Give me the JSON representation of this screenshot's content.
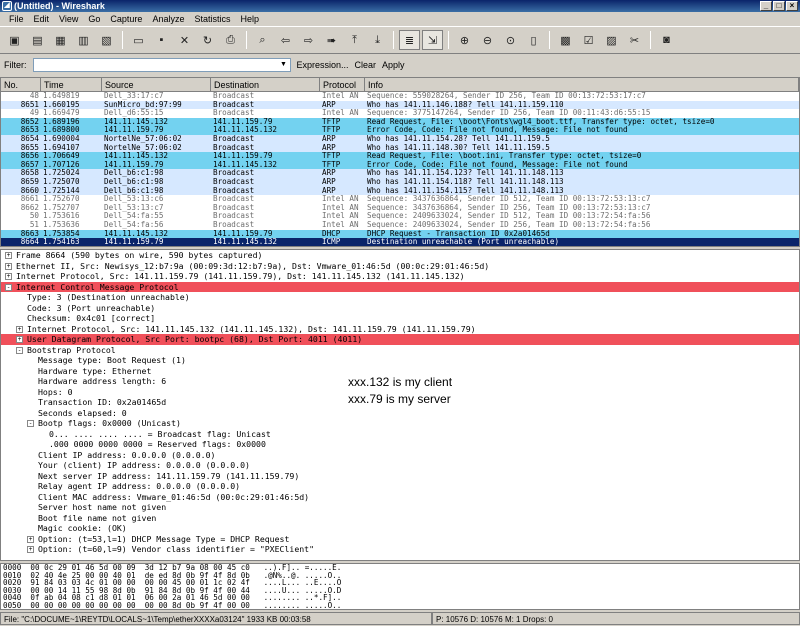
{
  "window": {
    "title": "(Untitled) - Wireshark",
    "app_icon": "wireshark-fin-icon"
  },
  "menu": [
    "File",
    "Edit",
    "View",
    "Go",
    "Capture",
    "Analyze",
    "Statistics",
    "Help"
  ],
  "toolbar": {
    "icons": [
      "interface-list-icon",
      "capture-options-icon",
      "start-capture-icon",
      "restart-capture-icon",
      "stop-capture-icon",
      "open-file-icon",
      "save-file-icon",
      "close-file-icon",
      "reload-icon",
      "print-icon",
      "find-packet-icon",
      "go-back-icon",
      "go-forward-icon",
      "go-to-packet-icon",
      "go-first-icon",
      "go-last-icon",
      "colorize-icon",
      "auto-scroll-icon",
      "zoom-in-icon",
      "zoom-out-icon",
      "zoom-normal-icon",
      "resize-columns-icon",
      "capture-filters-icon",
      "display-filters-icon",
      "coloring-rules-icon",
      "preferences-icon",
      "help-icon"
    ]
  },
  "filter": {
    "label": "Filter:",
    "value": "",
    "expression_label": "Expression...",
    "clear_label": "Clear",
    "apply_label": "Apply"
  },
  "packet_list": {
    "columns": [
      "No.",
      "Time",
      "Source",
      "Destination",
      "Protocol",
      "Info"
    ],
    "rows": [
      {
        "no": "48",
        "time": "1.649819",
        "src": "Dell_33:17:c7",
        "dst": "Broadcast",
        "proto": "Intel AN",
        "info": "Sequence: 559028264, Sender ID 256, Team ID 00:13:72:53:17:c7",
        "bg": "#ffffff",
        "fg": "#6e6e6e"
      },
      {
        "no": "8651",
        "time": "1.660195",
        "src": "SunMicro_bd:97:99",
        "dst": "Broadcast",
        "proto": "ARP",
        "info": "Who has 141.11.146.188?  Tell 141.11.159.110",
        "bg": "#d6e8ff",
        "fg": "#000000"
      },
      {
        "no": "49",
        "time": "1.669479",
        "src": "Dell_d6:55:15",
        "dst": "Broadcast",
        "proto": "Intel AN",
        "info": "Sequence: 3775147264, Sender ID 256, Team ID 00:11:43:d6:55:15",
        "bg": "#ffffff",
        "fg": "#6e6e6e"
      },
      {
        "no": "8652",
        "time": "1.689196",
        "src": "141.11.145.132",
        "dst": "141.11.159.79",
        "proto": "TFTP",
        "info": "Read Request, File: \\boot\\Fonts\\wgl4_boot.ttf, Transfer type: octet, tsize=0",
        "bg": "#73d2f0",
        "fg": "#000000"
      },
      {
        "no": "8653",
        "time": "1.689800",
        "src": "141.11.159.79",
        "dst": "141.11.145.132",
        "proto": "TFTP",
        "info": "Error Code, Code: File not found, Message: File not found",
        "bg": "#73d2f0",
        "fg": "#000000"
      },
      {
        "no": "8654",
        "time": "1.690004",
        "src": "NortelNe_57:06:02",
        "dst": "Broadcast",
        "proto": "ARP",
        "info": "Who has 141.11.154.28?  Tell 141.11.159.5",
        "bg": "#d6e8ff",
        "fg": "#000000"
      },
      {
        "no": "8655",
        "time": "1.694107",
        "src": "NortelNe_57:06:02",
        "dst": "Broadcast",
        "proto": "ARP",
        "info": "Who has 141.11.148.30?  Tell 141.11.159.5",
        "bg": "#d6e8ff",
        "fg": "#000000"
      },
      {
        "no": "8656",
        "time": "1.706649",
        "src": "141.11.145.132",
        "dst": "141.11.159.79",
        "proto": "TFTP",
        "info": "Read Request, File: \\boot.ini, Transfer type: octet, tsize=0",
        "bg": "#73d2f0",
        "fg": "#000000"
      },
      {
        "no": "8657",
        "time": "1.707126",
        "src": "141.11.159.79",
        "dst": "141.11.145.132",
        "proto": "TFTP",
        "info": "Error Code, Code: File not found, Message: File not found",
        "bg": "#73d2f0",
        "fg": "#000000"
      },
      {
        "no": "8658",
        "time": "1.725024",
        "src": "Dell_b6:c1:98",
        "dst": "Broadcast",
        "proto": "ARP",
        "info": "Who has 141.11.154.123?  Tell 141.11.148.113",
        "bg": "#d6e8ff",
        "fg": "#000000"
      },
      {
        "no": "8659",
        "time": "1.725070",
        "src": "Dell_b6:c1:98",
        "dst": "Broadcast",
        "proto": "ARP",
        "info": "Who has 141.11.154.118?  Tell 141.11.148.113",
        "bg": "#d6e8ff",
        "fg": "#000000"
      },
      {
        "no": "8660",
        "time": "1.725144",
        "src": "Dell_b6:c1:98",
        "dst": "Broadcast",
        "proto": "ARP",
        "info": "Who has 141.11.154.115?  Tell 141.11.148.113",
        "bg": "#d6e8ff",
        "fg": "#000000"
      },
      {
        "no": "8661",
        "time": "1.752670",
        "src": "Dell_53:13:c6",
        "dst": "Broadcast",
        "proto": "Intel AN",
        "info": "Sequence: 3437636864, Sender ID 512, Team ID 00:13:72:53:13:c7",
        "bg": "#ffffff",
        "fg": "#6e6e6e"
      },
      {
        "no": "8662",
        "time": "1.752707",
        "src": "Dell_53:13:c7",
        "dst": "Broadcast",
        "proto": "Intel AN",
        "info": "Sequence: 3437636864, Sender ID 256, Team ID 00:13:72:53:13:c7",
        "bg": "#ffffff",
        "fg": "#6e6e6e"
      },
      {
        "no": "50",
        "time": "1.753616",
        "src": "Dell_54:fa:55",
        "dst": "Broadcast",
        "proto": "Intel AN",
        "info": "Sequence: 2409633024, Sender ID 512, Team ID 00:13:72:54:fa:56",
        "bg": "#ffffff",
        "fg": "#6e6e6e"
      },
      {
        "no": "51",
        "time": "1.753636",
        "src": "Dell_54:fa:56",
        "dst": "Broadcast",
        "proto": "Intel AN",
        "info": "Sequence: 2409633024, Sender ID 256, Team ID 00:13:72:54:fa:56",
        "bg": "#ffffff",
        "fg": "#6e6e6e"
      },
      {
        "no": "8663",
        "time": "1.753854",
        "src": "141.11.145.132",
        "dst": "141.11.159.79",
        "proto": "DHCP",
        "info": "DHCP Request  - Transaction ID 0x2a01465d",
        "bg": "#73d2f0",
        "fg": "#000000"
      },
      {
        "no": "8664",
        "time": "1.754163",
        "src": "141.11.159.79",
        "dst": "141.11.145.132",
        "proto": "ICMP",
        "info": "Destination unreachable (Port unreachable)",
        "bg": "#0a246a",
        "fg": "#ffffff"
      }
    ]
  },
  "details": [
    {
      "indent": 0,
      "exp": "+",
      "text": "Frame 8664 (590 bytes on wire, 590 bytes captured)",
      "hl": false
    },
    {
      "indent": 0,
      "exp": "+",
      "text": "Ethernet II, Src: Newisys_12:b7:9a (00:09:3d:12:b7:9a), Dst: Vmware_01:46:5d (00:0c:29:01:46:5d)",
      "hl": false
    },
    {
      "indent": 0,
      "exp": "+",
      "text": "Internet Protocol, Src: 141.11.159.79 (141.11.159.79), Dst: 141.11.145.132 (141.11.145.132)",
      "hl": false
    },
    {
      "indent": 0,
      "exp": "-",
      "text": "Internet Control Message Protocol",
      "hl": true
    },
    {
      "indent": 1,
      "exp": "",
      "text": "Type: 3 (Destination unreachable)",
      "hl": false
    },
    {
      "indent": 1,
      "exp": "",
      "text": "Code: 3 (Port unreachable)",
      "hl": false
    },
    {
      "indent": 1,
      "exp": "",
      "text": "Checksum: 0x4c01 [correct]",
      "hl": false
    },
    {
      "indent": 1,
      "exp": "+",
      "text": "Internet Protocol, Src: 141.11.145.132 (141.11.145.132), Dst: 141.11.159.79 (141.11.159.79)",
      "hl": false
    },
    {
      "indent": 1,
      "exp": "+",
      "text": "User Datagram Protocol, Src Port: bootpc (68), Dst Port: 4011 (4011)",
      "hl": true
    },
    {
      "indent": 1,
      "exp": "-",
      "text": "Bootstrap Protocol",
      "hl": false
    },
    {
      "indent": 2,
      "exp": "",
      "text": "Message type: Boot Request (1)",
      "hl": false
    },
    {
      "indent": 2,
      "exp": "",
      "text": "Hardware type: Ethernet",
      "hl": false
    },
    {
      "indent": 2,
      "exp": "",
      "text": "Hardware address length: 6",
      "hl": false
    },
    {
      "indent": 2,
      "exp": "",
      "text": "Hops: 0",
      "hl": false
    },
    {
      "indent": 2,
      "exp": "",
      "text": "Transaction ID: 0x2a01465d",
      "hl": false
    },
    {
      "indent": 2,
      "exp": "",
      "text": "Seconds elapsed: 0",
      "hl": false
    },
    {
      "indent": 2,
      "exp": "-",
      "text": "Bootp flags: 0x0000 (Unicast)",
      "hl": false
    },
    {
      "indent": 3,
      "exp": "",
      "text": "0... .... .... .... = Broadcast flag: Unicast",
      "hl": false
    },
    {
      "indent": 3,
      "exp": "",
      "text": ".000 0000 0000 0000 = Reserved flags: 0x0000",
      "hl": false
    },
    {
      "indent": 2,
      "exp": "",
      "text": "Client IP address: 0.0.0.0 (0.0.0.0)",
      "hl": false
    },
    {
      "indent": 2,
      "exp": "",
      "text": "Your (client) IP address: 0.0.0.0 (0.0.0.0)",
      "hl": false
    },
    {
      "indent": 2,
      "exp": "",
      "text": "Next server IP address: 141.11.159.79 (141.11.159.79)",
      "hl": false
    },
    {
      "indent": 2,
      "exp": "",
      "text": "Relay agent IP address: 0.0.0.0 (0.0.0.0)",
      "hl": false
    },
    {
      "indent": 2,
      "exp": "",
      "text": "Client MAC address: Vmware_01:46:5d (00:0c:29:01:46:5d)",
      "hl": false
    },
    {
      "indent": 2,
      "exp": "",
      "text": "Server host name not given",
      "hl": false
    },
    {
      "indent": 2,
      "exp": "",
      "text": "Boot file name not given",
      "hl": false
    },
    {
      "indent": 2,
      "exp": "",
      "text": "Magic cookie: (OK)",
      "hl": false
    },
    {
      "indent": 2,
      "exp": "+",
      "text": "Option: (t=53,l=1) DHCP Message Type = DHCP Request",
      "hl": false
    },
    {
      "indent": 2,
      "exp": "+",
      "text": "Option: (t=60,l=9) Vendor class identifier = \"PXEClient\"",
      "hl": false
    }
  ],
  "annotation": {
    "line1": "xxx.132 is my client",
    "line2": "xxx.79 is my server"
  },
  "hex": [
    "0000  00 0c 29 01 46 5d 00 09  3d 12 b7 9a 08 00 45 c0   ..).F].. =.....E.",
    "0010  02 40 4e 25 00 00 40 01  de ed 8d 0b 9f 4f 8d 0b   .@N%..@. .....O..",
    "0020  91 84 03 03 4c 01 00 00  00 00 45 00 01 1c 02 4f   ....L... ..E....O",
    "0030  00 00 14 11 55 98 8d 0b  91 84 8d 0b 9f 4f 00 44   ....U... .....O.D",
    "0040  0f ab 04 08 c1 d8 01 01  06 00 2a 01 46 5d 00 00   ........ ..*.F]..",
    "0050  00 00 00 00 00 00 00 00  00 00 8d 0b 9f 4f 00 00   ........ .....O.."
  ],
  "status": {
    "file": "File: \"C:\\DOCUME~1\\REYTD\\LOCALS~1\\Temp\\etherXXXXa03124\" 1933 KB 00:03:58",
    "counts": "P: 10576 D: 10576 M: 1 Drops: 0"
  }
}
